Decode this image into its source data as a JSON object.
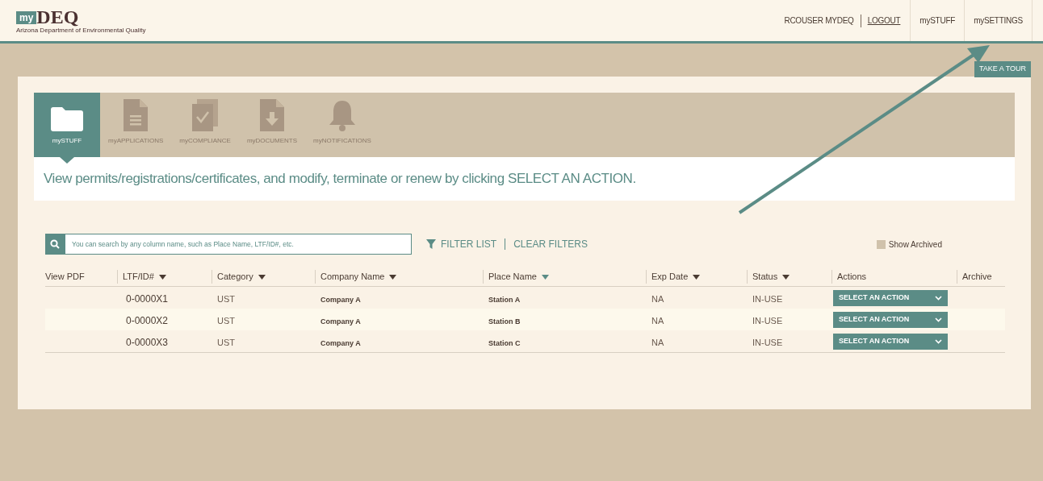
{
  "header": {
    "logo_text": "DEQ",
    "logo_badge": "my",
    "logo_subtitle": "Arizona Department of Environmental Quality",
    "user": "RCOUSER MYDEQ",
    "logout": "LOGOUT",
    "nav": [
      "mySTUFF",
      "mySETTINGS"
    ]
  },
  "tour_button": "TAKE A TOUR",
  "tabs": [
    {
      "label": "mySTUFF",
      "kind": "folder",
      "selected": true
    },
    {
      "label": "myAPPLICATIONS",
      "kind": "document",
      "selected": false
    },
    {
      "label": "myCOMPLIANCE",
      "kind": "checklist",
      "selected": false
    },
    {
      "label": "myDOCUMENTS",
      "kind": "download",
      "selected": false
    },
    {
      "label": "myNOTIFICATIONS",
      "kind": "bell",
      "selected": false
    }
  ],
  "intro": "View permits/registrations/certificates, and modify, terminate or renew by clicking SELECT AN ACTION.",
  "search": {
    "placeholder": "You can search by any column name, such as Place Name, LTF/ID#, etc."
  },
  "filter_list": "FILTER LIST",
  "clear_filters": "CLEAR FILTERS",
  "show_archived": {
    "label": "Show Archived",
    "checked": false
  },
  "table": {
    "columns": [
      {
        "label": "View PDF",
        "sortable": false,
        "sorted": false
      },
      {
        "label": "LTF/ID#",
        "sortable": true,
        "sorted": false
      },
      {
        "label": "Category",
        "sortable": true,
        "sorted": false
      },
      {
        "label": "Company Name",
        "sortable": true,
        "sorted": false
      },
      {
        "label": "Place Name",
        "sortable": true,
        "sorted": true
      },
      {
        "label": "Exp Date",
        "sortable": true,
        "sorted": false
      },
      {
        "label": "Status",
        "sortable": true,
        "sorted": false
      },
      {
        "label": "Actions",
        "sortable": false,
        "sorted": false
      },
      {
        "label": "Archive",
        "sortable": false,
        "sorted": false
      }
    ],
    "rows": [
      {
        "id": "0-0000X1",
        "category": "UST",
        "company": "Company A",
        "place": "Station A",
        "exp_date": "NA",
        "status": "IN-USE",
        "action": "SELECT AN ACTION"
      },
      {
        "id": "0-0000X2",
        "category": "UST",
        "company": "Company A",
        "place": "Station B",
        "exp_date": "NA",
        "status": "IN-USE",
        "action": "SELECT AN ACTION"
      },
      {
        "id": "0-0000X3",
        "category": "UST",
        "company": "Company A",
        "place": "Station C",
        "exp_date": "NA",
        "status": "IN-USE",
        "action": "SELECT AN ACTION"
      }
    ]
  }
}
